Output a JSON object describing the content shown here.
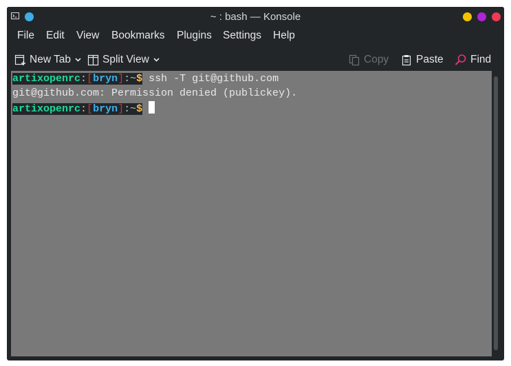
{
  "window": {
    "title": "~ : bash — Konsole",
    "app_icon": "konsole-terminal-icon",
    "controls": [
      {
        "name": "minimize",
        "color": "#f2c200"
      },
      {
        "name": "maximize",
        "color": "#b023d6"
      },
      {
        "name": "close",
        "color": "#ee3b52"
      }
    ],
    "pin_color": "#3daee9"
  },
  "menu": {
    "items": [
      "File",
      "Edit",
      "View",
      "Bookmarks",
      "Plugins",
      "Settings",
      "Help"
    ]
  },
  "toolbar": {
    "new_tab": {
      "label": "New Tab",
      "icon": "new-tab-icon"
    },
    "split_view": {
      "label": "Split View",
      "icon": "split-view-icon"
    },
    "copy": {
      "label": "Copy",
      "icon": "copy-icon",
      "enabled": false
    },
    "paste": {
      "label": "Paste",
      "icon": "paste-icon"
    },
    "find": {
      "label": "Find",
      "icon": "find-icon",
      "icon_color": "#e0357d"
    }
  },
  "terminal": {
    "background": "#797979",
    "prompt": {
      "host": "artixopenrc",
      "sep": ":",
      "open_bracket": "[",
      "user": "bryn",
      "close_bracket": "]",
      "path": ":~",
      "dollar": "$"
    },
    "lines": [
      {
        "type": "prompt",
        "command": " ssh -T git@github.com"
      },
      {
        "type": "output",
        "text": "git@github.com: Permission denied (publickey)."
      },
      {
        "type": "prompt",
        "command": " ",
        "cursor": true
      }
    ],
    "colors": {
      "host": "#1cdc9a",
      "user": "#3daee9",
      "bracket": "#c0392b",
      "dollar": "#fdbc4b"
    }
  }
}
